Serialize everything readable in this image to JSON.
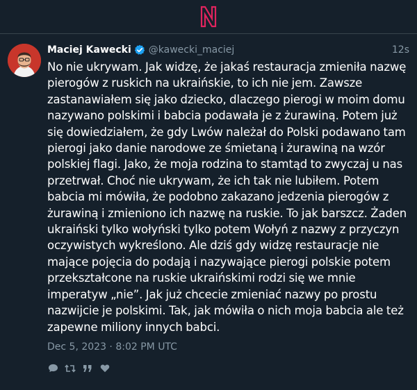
{
  "app": {
    "logo": "N"
  },
  "post": {
    "author_name": "Maciej Kawecki",
    "author_handle": "@kawecki_maciej",
    "relative_time": "12s",
    "text": "No nie ukrywam. Jak widzę, że jakaś restauracja zmieniła nazwę pierogów z ruskich na ukraińskie, to ich nie jem. Zawsze zastanawiałem się jako dziecko, dlaczego pierogi w moim domu nazywano polskimi i babcia podawała je z żurawiną. Potem już się dowiedziałem, że gdy Lwów należał do Polski podawano tam pierogi jako danie narodowe ze śmietaną i żurawiną na wzór polskiej flagi. Jako, że moja rodzina to stamtąd to zwyczaj u nas przetrwał. Choć nie ukrywam, że ich tak nie lubiłem. Potem babcia mi mówiła, że podobno zakazano jedzenia pierogów z żurawiną i zmieniono ich nazwę na ruskie. To jak barszcz. Żaden ukraiński tylko wołyński tylko potem Wołyń z nazwy z przyczyn oczywistych wykreślono. Ale dziś gdy widzę restauracje nie mające pojęcia do podają i nazywające pierogi polskie potem przekształcone na ruskie ukraińskimi rodzi się we mnie imperatyw „nie”. Jak już chcecie zmieniać nazwy po prostu nazwijcie je polskimi. Tak, jak mówiła o nich moja babcia ale też zapewne miliony innych babci.",
    "timestamp": "Dec 5, 2023 · 8:02 PM UTC"
  },
  "icons": {
    "verified": "verified-badge-icon",
    "reply": "reply-icon",
    "retweet": "retweet-icon",
    "quote": "quote-icon",
    "like": "heart-icon"
  },
  "colors": {
    "background": "#15202b",
    "accent_logo": "#e0245e",
    "verified": "#1da1f2",
    "muted": "#8899a6",
    "divider": "#38444d"
  }
}
